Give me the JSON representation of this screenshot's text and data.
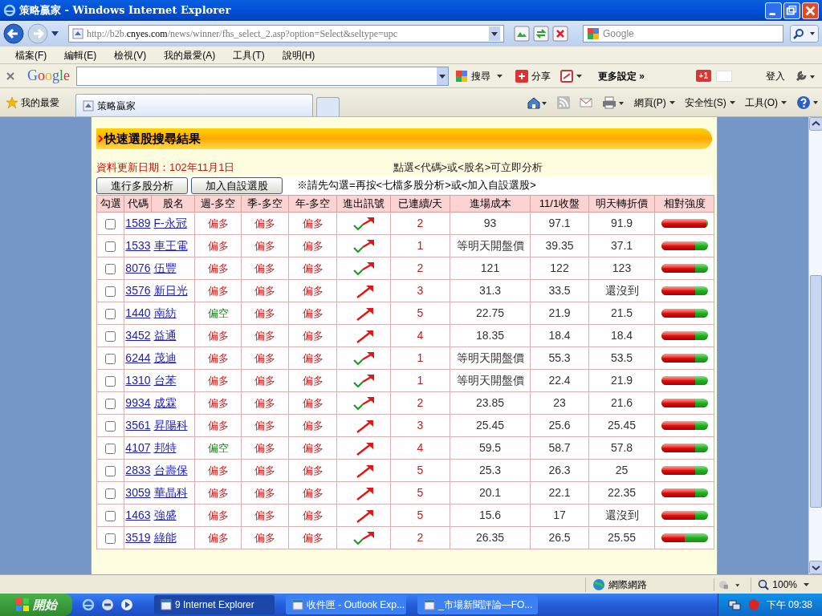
{
  "window": {
    "title": "策略贏家 - Windows Internet Explorer"
  },
  "address_bar": {
    "url_host": "http://b2b.",
    "url_domain": "cnyes.com",
    "url_path": "/news/winner/fhs_select_2.asp?option=Select&seltype=upc",
    "search_placeholder": "Google"
  },
  "menu": [
    "檔案(F)",
    "編輯(E)",
    "檢視(V)",
    "我的最愛(A)",
    "工具(T)",
    "說明(H)"
  ],
  "google_toolbar": {
    "logo": "Google",
    "search": "搜尋",
    "share": "分享",
    "more": "更多設定 »",
    "plus": "+1",
    "signin": "登入"
  },
  "favorites_bar": {
    "favorites": "我的最愛",
    "tab": "策略贏家",
    "commands": [
      "網頁(P)",
      "安全性(S)",
      "工具(O)"
    ]
  },
  "page": {
    "heading": "快速選股搜尋結果",
    "update_date": "資料更新日期：102年11月1日",
    "hint": "點選<代碼>或<股名>可立即分析",
    "buttons": [
      "進行多股分析",
      "加入自設選股"
    ],
    "note": "※請先勾選=再按<七檔多股分析>或<加入自設選股>"
  },
  "table": {
    "columns": [
      "勾選",
      "代碼",
      "股名",
      "週-多空",
      "季-多空",
      "年-多空",
      "進出訊號",
      "已連續/天",
      "進場成本",
      "11/1收盤",
      "明天轉折價",
      "相對強度"
    ],
    "rows": [
      {
        "kind": "check-arrow",
        "checked": false,
        "code": "1589",
        "name": "F-永冠",
        "week": {
          "text": "偏多",
          "kind": "bull"
        },
        "season": "偏多",
        "year": "偏多",
        "days": "2",
        "cost": "93",
        "close": "97.1",
        "turn": "91.9",
        "level": 0.97
      },
      {
        "kind": "check-arrow",
        "checked": false,
        "code": "1533",
        "name": "車王電",
        "week": {
          "text": "偏多",
          "kind": "bull"
        },
        "season": "偏多",
        "year": "偏多",
        "days": "1",
        "cost": "等明天開盤價",
        "close": "39.35",
        "turn": "37.1",
        "level": 0.73
      },
      {
        "kind": "check-arrow",
        "checked": false,
        "code": "8076",
        "name": "伍豐",
        "week": {
          "text": "偏多",
          "kind": "bull"
        },
        "season": "偏多",
        "year": "偏多",
        "days": "2",
        "cost": "121",
        "close": "122",
        "turn": "123",
        "level": 0.73
      },
      {
        "kind": "arrow",
        "checked": false,
        "code": "3576",
        "name": "新日光",
        "week": {
          "text": "偏多",
          "kind": "bull"
        },
        "season": "偏多",
        "year": "偏多",
        "days": "3",
        "cost": "31.3",
        "close": "33.5",
        "turn": "還沒到",
        "level": 0.73
      },
      {
        "kind": "arrow",
        "checked": false,
        "code": "1440",
        "name": "南紡",
        "week": {
          "text": "偏空",
          "kind": "bear"
        },
        "season": "偏多",
        "year": "偏多",
        "days": "5",
        "cost": "22.75",
        "close": "21.9",
        "turn": "21.5",
        "level": 0.73
      },
      {
        "kind": "arrow",
        "checked": false,
        "code": "3452",
        "name": "益通",
        "week": {
          "text": "偏多",
          "kind": "bull"
        },
        "season": "偏多",
        "year": "偏多",
        "days": "4",
        "cost": "18.35",
        "close": "18.4",
        "turn": "18.4",
        "level": 0.73
      },
      {
        "kind": "check-arrow",
        "checked": false,
        "code": "6244",
        "name": "茂迪",
        "week": {
          "text": "偏多",
          "kind": "bull"
        },
        "season": "偏多",
        "year": "偏多",
        "days": "1",
        "cost": "等明天開盤價",
        "close": "55.3",
        "turn": "53.5",
        "level": 0.73
      },
      {
        "kind": "check-arrow",
        "checked": false,
        "code": "1310",
        "name": "台苯",
        "week": {
          "text": "偏多",
          "kind": "bull"
        },
        "season": "偏多",
        "year": "偏多",
        "days": "1",
        "cost": "等明天開盤價",
        "close": "22.4",
        "turn": "21.9",
        "level": 0.73
      },
      {
        "kind": "check-arrow",
        "checked": false,
        "code": "9934",
        "name": "成霖",
        "week": {
          "text": "偏多",
          "kind": "bull"
        },
        "season": "偏多",
        "year": "偏多",
        "days": "2",
        "cost": "23.85",
        "close": "23",
        "turn": "21.6",
        "level": 0.73
      },
      {
        "kind": "arrow",
        "checked": false,
        "code": "3561",
        "name": "昇陽科",
        "week": {
          "text": "偏多",
          "kind": "bull"
        },
        "season": "偏多",
        "year": "偏多",
        "days": "3",
        "cost": "25.45",
        "close": "25.6",
        "turn": "25.45",
        "level": 0.73
      },
      {
        "kind": "arrow",
        "checked": false,
        "code": "4107",
        "name": "邦特",
        "week": {
          "text": "偏空",
          "kind": "bear"
        },
        "season": "偏多",
        "year": "偏多",
        "days": "4",
        "cost": "59.5",
        "close": "58.7",
        "turn": "57.8",
        "level": 0.73
      },
      {
        "kind": "arrow",
        "checked": false,
        "code": "2833",
        "name": "台壽保",
        "week": {
          "text": "偏多",
          "kind": "bull"
        },
        "season": "偏多",
        "year": "偏多",
        "days": "5",
        "cost": "25.3",
        "close": "26.3",
        "turn": "25",
        "level": 0.73
      },
      {
        "kind": "arrow",
        "checked": false,
        "code": "3059",
        "name": "華晶科",
        "week": {
          "text": "偏多",
          "kind": "bull"
        },
        "season": "偏多",
        "year": "偏多",
        "days": "5",
        "cost": "20.1",
        "close": "22.1",
        "turn": "22.35",
        "level": 0.73
      },
      {
        "kind": "arrow",
        "checked": false,
        "code": "1463",
        "name": "強盛",
        "week": {
          "text": "偏多",
          "kind": "bull"
        },
        "season": "偏多",
        "year": "偏多",
        "days": "5",
        "cost": "15.6",
        "close": "17",
        "turn": "還沒到",
        "level": 0.73
      },
      {
        "kind": "check-arrow",
        "checked": false,
        "code": "3519",
        "name": "綠能",
        "week": {
          "text": "偏多",
          "kind": "bull"
        },
        "season": "偏多",
        "year": "偏多",
        "days": "2",
        "cost": "26.35",
        "close": "26.5",
        "turn": "25.55",
        "level": 0.5
      }
    ]
  },
  "status_bar": {
    "zone": "網際網路",
    "zoom": "100%"
  },
  "taskbar": {
    "start": "開始",
    "windows": [
      {
        "label": "9 Internet Explorer",
        "selected": true
      },
      {
        "label": "收件匣 - Outlook Exp...",
        "selected": false
      },
      {
        "label": "_市場新聞評論—FO...",
        "selected": false
      }
    ],
    "clock": "下午 09:38"
  }
}
